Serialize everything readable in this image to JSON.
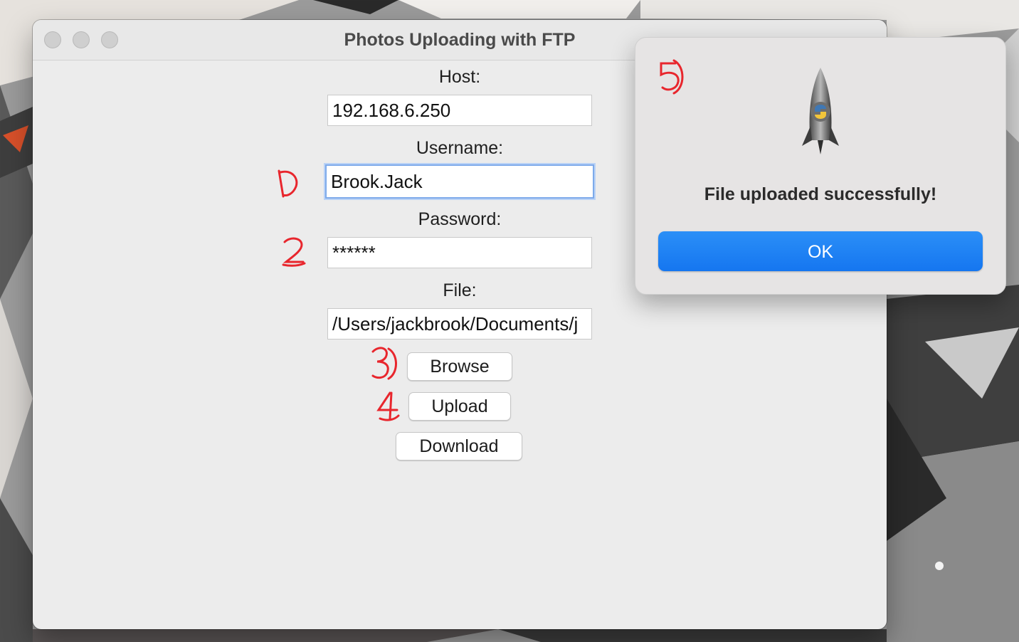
{
  "window": {
    "title": "Photos Uploading with FTP"
  },
  "form": {
    "host_label": "Host:",
    "host_value": "192.168.6.250",
    "username_label": "Username:",
    "username_value": "Brook.Jack",
    "password_label": "Password:",
    "password_value": "******",
    "file_label": "File:",
    "file_value": "/Users/jackbrook/Documents/j"
  },
  "buttons": {
    "browse": "Browse",
    "upload": "Upload",
    "download": "Download"
  },
  "dialog": {
    "message": "File uploaded successfully!",
    "ok": "OK",
    "icon": "python-launcher-rocket-icon"
  },
  "annotations": [
    "1",
    "2",
    "3",
    "4",
    "5"
  ],
  "colors": {
    "accent": "#1a7ff3",
    "marker": "#e8262d",
    "focus_ring": "#7eaaea"
  }
}
